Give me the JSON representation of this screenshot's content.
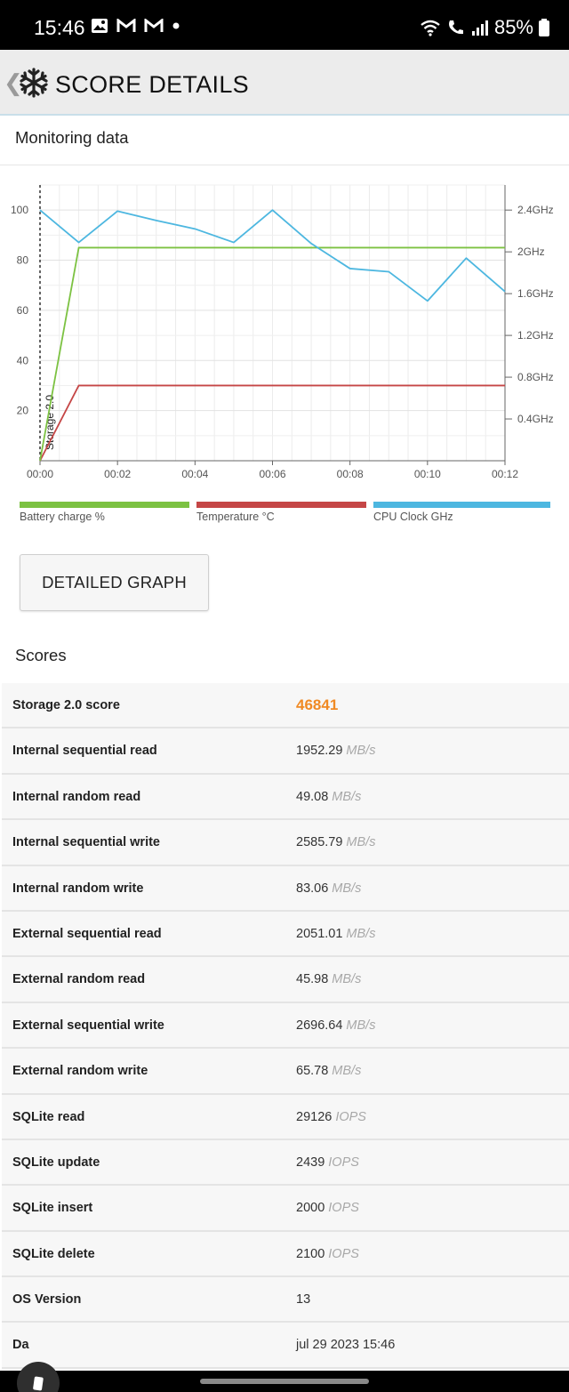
{
  "status_bar": {
    "time": "15:46",
    "battery_pct": "85%",
    "left_icons": [
      "gallery-icon",
      "gmail-icon",
      "gmail-icon",
      "dot-icon"
    ],
    "right_icons": [
      "wifi-calling-icon",
      "call-icon",
      "signal-icon",
      "battery-icon"
    ]
  },
  "app_bar": {
    "title": "SCORE DETAILS"
  },
  "monitoring": {
    "title": "Monitoring data"
  },
  "chart_data": {
    "type": "line",
    "x": [
      "00:00",
      "00:01",
      "00:02",
      "00:03",
      "00:04",
      "00:05",
      "00:06",
      "00:07",
      "00:08",
      "00:09",
      "00:10",
      "00:11",
      "00:12"
    ],
    "x_ticks": [
      "00:00",
      "00:02",
      "00:04",
      "00:06",
      "00:08",
      "00:10",
      "00:12"
    ],
    "y_left_ticks": [
      20,
      40,
      60,
      80,
      100
    ],
    "y_left_range": [
      0,
      110
    ],
    "y_right_ticks": [
      "0.4GHz",
      "0.8GHz",
      "1.2GHz",
      "1.6GHz",
      "2GHz",
      "2.4GHz"
    ],
    "y_right_range_ghz": [
      0,
      2.64
    ],
    "marker_label": "Storage 2.0",
    "series": [
      {
        "name": "Battery charge %",
        "color": "#7cc242",
        "axis": "left",
        "values": [
          0,
          85,
          85,
          85,
          85,
          85,
          85,
          85,
          85,
          85,
          85,
          85,
          85
        ]
      },
      {
        "name": "Temperature °C",
        "color": "#c54646",
        "axis": "left",
        "values": [
          0,
          30,
          30,
          30,
          30,
          30,
          30,
          30,
          30,
          30,
          30,
          30,
          30
        ]
      },
      {
        "name": "CPU Clock GHz",
        "color": "#4db7e0",
        "axis": "right",
        "values": [
          2.4,
          2.09,
          2.39,
          2.3,
          2.22,
          2.09,
          2.4,
          2.08,
          1.84,
          1.81,
          1.53,
          1.94,
          1.62
        ]
      }
    ]
  },
  "legend": [
    {
      "label": "Battery charge %",
      "color": "#7cc242"
    },
    {
      "label": "Temperature °C",
      "color": "#c54646"
    },
    {
      "label": "CPU Clock GHz",
      "color": "#4db7e0"
    }
  ],
  "detailed_graph_button": "DETAILED GRAPH",
  "scores": {
    "title": "Scores",
    "rows": [
      {
        "label": "Storage 2.0 score",
        "value": "46841",
        "unit": "",
        "highlight": true
      },
      {
        "label": "Internal sequential read",
        "value": "1952.29",
        "unit": "MB/s"
      },
      {
        "label": "Internal random read",
        "value": "49.08",
        "unit": "MB/s"
      },
      {
        "label": "Internal sequential write",
        "value": "2585.79",
        "unit": "MB/s"
      },
      {
        "label": "Internal random write",
        "value": "83.06",
        "unit": "MB/s"
      },
      {
        "label": "External sequential read",
        "value": "2051.01",
        "unit": "MB/s"
      },
      {
        "label": "External random read",
        "value": "45.98",
        "unit": "MB/s"
      },
      {
        "label": "External sequential write",
        "value": "2696.64",
        "unit": "MB/s"
      },
      {
        "label": "External random write",
        "value": "65.78",
        "unit": "MB/s"
      },
      {
        "label": "SQLite read",
        "value": "29126",
        "unit": "IOPS"
      },
      {
        "label": "SQLite update",
        "value": "2439",
        "unit": "IOPS"
      },
      {
        "label": "SQLite insert",
        "value": "2000",
        "unit": "IOPS"
      },
      {
        "label": "SQLite delete",
        "value": "2100",
        "unit": "IOPS"
      },
      {
        "label": "OS Version",
        "value": "13",
        "unit": ""
      },
      {
        "label": "Da",
        "value": "jul 29 2023 15:46",
        "unit": ""
      }
    ]
  }
}
